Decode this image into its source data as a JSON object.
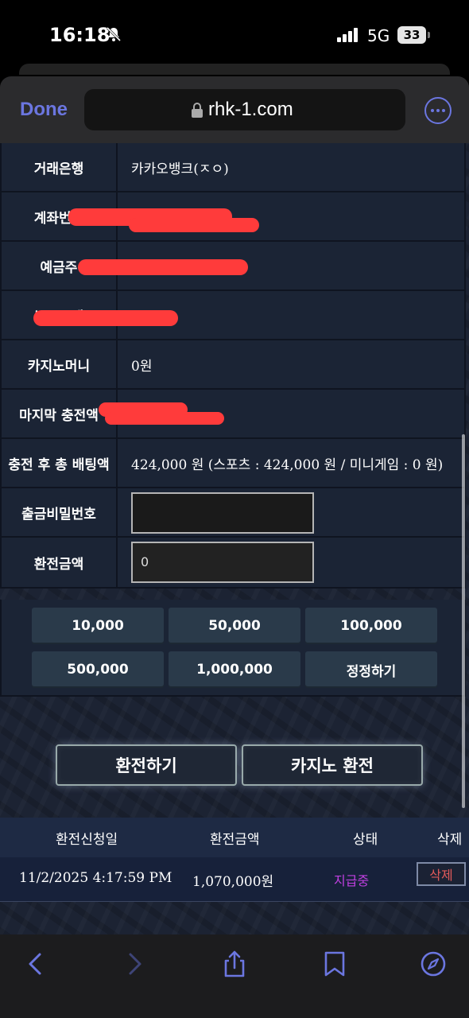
{
  "status_bar": {
    "time": "16:18",
    "network": "5G",
    "battery": "33"
  },
  "browser": {
    "done_label": "Done",
    "url": "rhk-1.com"
  },
  "form_rows": [
    {
      "label": "거래은행",
      "value": "카카오뱅크(ㅈㅇ)"
    },
    {
      "label": "계좌번호",
      "value": ""
    },
    {
      "label": "예금주",
      "value": ""
    },
    {
      "label": "보유금액",
      "value": ""
    },
    {
      "label": "카지노머니",
      "value": "0원"
    },
    {
      "label": "마지막 충전액",
      "value": ""
    },
    {
      "label": "충전 후 총 배팅액",
      "value": "424,000 원 (스포츠 : 424,000 원 / 미니게임 : 0 원)"
    },
    {
      "label": "출금비밀번호",
      "value": ""
    },
    {
      "label": "환전금액",
      "value": "0"
    }
  ],
  "amount_chips": [
    "10,000",
    "50,000",
    "100,000",
    "500,000",
    "1,000,000",
    "정정하기"
  ],
  "actions": {
    "exchange": "환전하기",
    "casino_exchange": "카지노 환전"
  },
  "history": {
    "headers": [
      "환전신청일",
      "환전금액",
      "상태",
      "삭제"
    ],
    "rows": [
      {
        "date": "11/2/2025 4:17:59 PM",
        "amount": "1,070,000원",
        "status": "지급중",
        "delete": "삭제"
      }
    ]
  },
  "colors": {
    "accent": "#6b76e0",
    "status_paying": "#c040e0",
    "delete_text": "#e25a5a",
    "redaction": "#ff3b3b"
  }
}
